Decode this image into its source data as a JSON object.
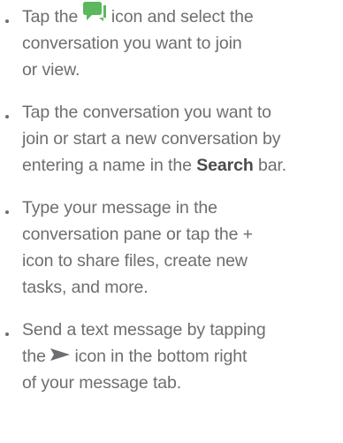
{
  "instructions": [
    {
      "lines": [
        {
          "pre": "Tap the",
          "icon": "chat-bubbles-icon",
          "post": "icon and select the"
        },
        {
          "text": "conversation you want to join"
        },
        {
          "text": "or view."
        }
      ]
    },
    {
      "lines": [
        {
          "text": "Tap the conversation you want to"
        },
        {
          "text": "join or start a new conversation by"
        },
        {
          "pre": "entering a name in the",
          "bold": "Search",
          "post": "bar."
        }
      ]
    },
    {
      "lines": [
        {
          "text": "Type your message in the"
        },
        {
          "text": "conversation pane or tap the +"
        },
        {
          "text": "icon to share files, create new"
        },
        {
          "text": "tasks, and more."
        }
      ]
    },
    {
      "lines": [
        {
          "text": "Send a text message by tapping"
        },
        {
          "pre": "the",
          "icon": "send-arrow-icon",
          "post": "icon in the bottom right"
        },
        {
          "text": "of your message tab."
        }
      ]
    }
  ],
  "colors": {
    "text": "#6d6e71",
    "bold": "#4a4b4d",
    "chat_icon": "#5cb85c",
    "send_icon": "#6d6e71"
  }
}
